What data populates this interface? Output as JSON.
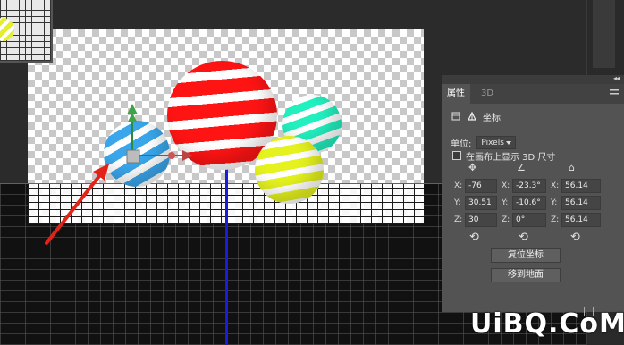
{
  "panel": {
    "tabs": [
      {
        "label": "属性"
      },
      {
        "label": "3D"
      }
    ],
    "section_title": "坐标",
    "unit_label": "单位:",
    "unit_value": "Pixels",
    "show_on_canvas_label": "在画布上显示 3D 尺寸",
    "columns": {
      "position": {
        "x": "-76",
        "y": "30.51",
        "z": "30"
      },
      "rotation": {
        "x": "-23.3°",
        "y": "-10.6°",
        "z": "0°"
      },
      "scale": {
        "x": "56.14",
        "y": "56.14",
        "z": "56.14"
      }
    },
    "axis_labels": {
      "x": "X:",
      "y": "Y:",
      "z": "Z:"
    },
    "reset_button": "复位坐标",
    "move_to_ground_button": "移到地面"
  },
  "icons": {
    "move": "move-icon",
    "rotate": "rotate-icon",
    "scale": "scale-icon",
    "reset": "reset-icon"
  },
  "watermark": "UiBQ.CoM",
  "colors": {
    "accent_red_arrow": "#e2231a",
    "axis_blue": "#1b1bd8",
    "axis_red": "#c03a3a",
    "panel_bg": "#535353"
  }
}
